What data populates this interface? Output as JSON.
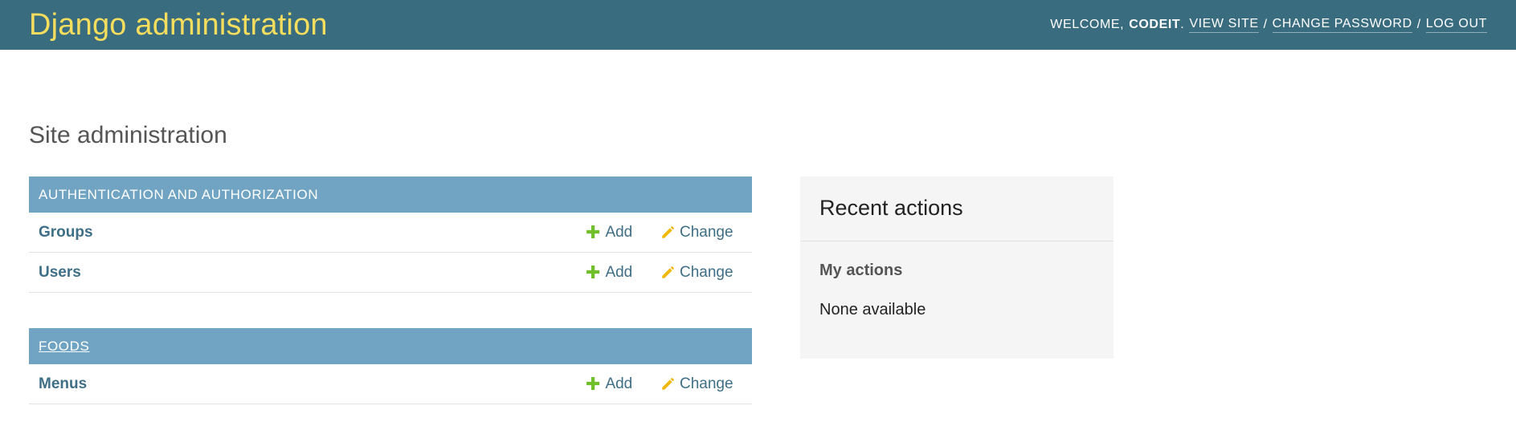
{
  "header": {
    "brand": "Django administration",
    "welcome": "Welcome,",
    "username": "CODEIT",
    "view_site": "View site",
    "change_password": "Change password",
    "log_out": "Log out",
    "separator": "/",
    "period": "."
  },
  "page": {
    "title": "Site administration"
  },
  "modules": [
    {
      "caption": "Authentication and Authorization",
      "rows": [
        {
          "name": "Groups",
          "add": "Add",
          "change": "Change"
        },
        {
          "name": "Users",
          "add": "Add",
          "change": "Change"
        }
      ]
    },
    {
      "caption": "Foods",
      "rows": [
        {
          "name": "Menus",
          "add": "Add",
          "change": "Change"
        }
      ]
    }
  ],
  "recent_actions": {
    "title": "Recent actions",
    "subtitle": "My actions",
    "empty": "None available"
  },
  "icons": {
    "add": "plus-icon",
    "change": "pencil-icon"
  },
  "colors": {
    "header_bg": "#3a6c80",
    "brand": "#f5dd5d",
    "module_caption_bg": "#70a4c2",
    "link": "#3f6f86",
    "add_icon": "#70bf2b",
    "change_icon": "#efb80b",
    "recent_bg": "#f5f5f5"
  }
}
